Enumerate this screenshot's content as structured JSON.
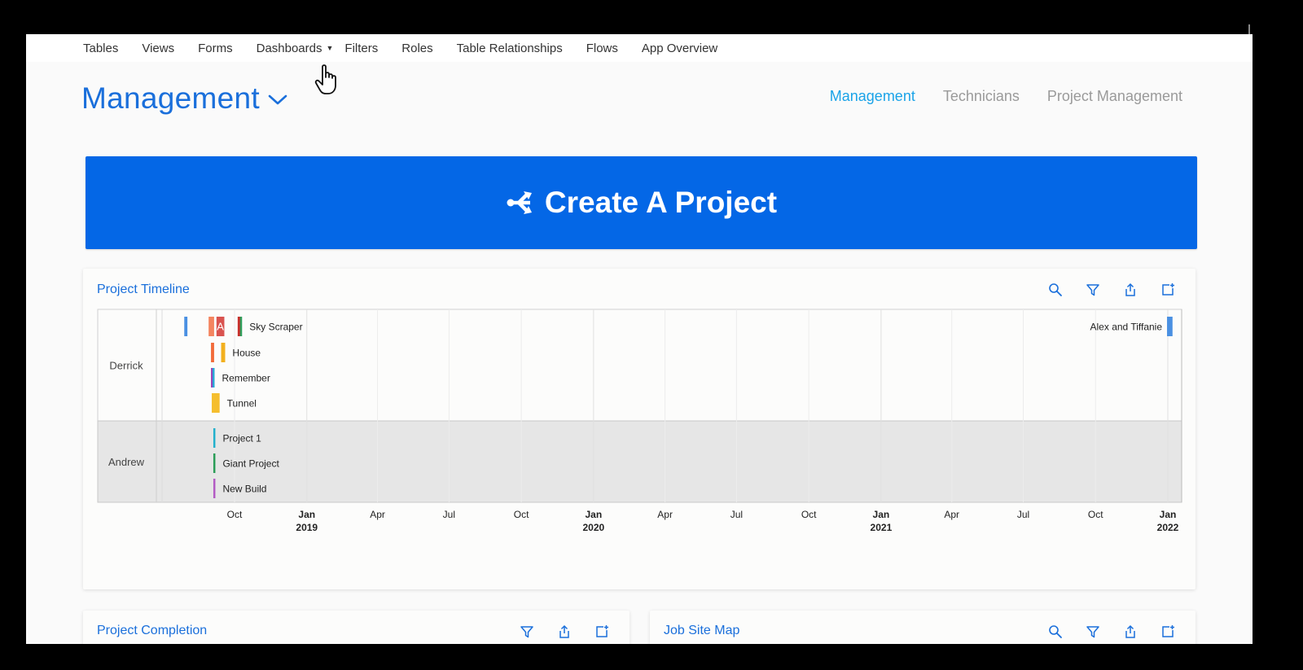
{
  "nav": {
    "items": [
      "Tables",
      "Views",
      "Forms",
      "Dashboards",
      "Filters",
      "Roles",
      "Table Relationships",
      "Flows",
      "App Overview"
    ],
    "dropdown_item": "Dashboards"
  },
  "page": {
    "title": "Management",
    "tabs": [
      {
        "label": "Management",
        "active": true
      },
      {
        "label": "Technicians",
        "active": false
      },
      {
        "label": "Project Management",
        "active": false
      }
    ]
  },
  "create_button": {
    "label": "Create A Project",
    "icon": "share-nodes-icon"
  },
  "timeline": {
    "title": "Project Timeline",
    "icons": [
      "search-icon",
      "filter-icon",
      "export-icon",
      "expand-icon"
    ]
  },
  "chart_data": {
    "type": "timeline",
    "rows": [
      "Derrick",
      "Andrew"
    ],
    "x_ticks": [
      {
        "month": "Oct",
        "year": ""
      },
      {
        "month": "Jan",
        "year": "2019"
      },
      {
        "month": "Apr",
        "year": ""
      },
      {
        "month": "Jul",
        "year": ""
      },
      {
        "month": "Oct",
        "year": ""
      },
      {
        "month": "Jan",
        "year": "2020"
      },
      {
        "month": "Apr",
        "year": ""
      },
      {
        "month": "Jul",
        "year": ""
      },
      {
        "month": "Oct",
        "year": ""
      },
      {
        "month": "Jan",
        "year": "2021"
      },
      {
        "month": "Apr",
        "year": ""
      },
      {
        "month": "Jul",
        "year": ""
      },
      {
        "month": "Oct",
        "year": ""
      },
      {
        "month": "Jan",
        "year": "2022"
      }
    ],
    "bars": [
      {
        "row": "Derrick",
        "lane": 0,
        "start": "2018-07-29",
        "end": "2018-08-02",
        "color": "#4a90e2",
        "label": ""
      },
      {
        "row": "Derrick",
        "lane": 0,
        "start": "2018-08-29",
        "end": "2018-09-05",
        "color": "#f4845f",
        "label": ""
      },
      {
        "row": "Derrick",
        "lane": 0,
        "start": "2018-09-08",
        "end": "2018-09-18",
        "color": "#d9534f",
        "label": "A"
      },
      {
        "row": "Derrick",
        "lane": 0,
        "start": "2018-10-05",
        "end": "2018-10-09",
        "color": "#c9302c",
        "label": ""
      },
      {
        "row": "Derrick",
        "lane": 0,
        "start": "2018-10-08",
        "end": "2018-10-10",
        "color": "#2e9e5b",
        "label": "Sky Scraper"
      },
      {
        "row": "Derrick",
        "lane": 0,
        "start": "2021-12-31",
        "end": "2022-01-07",
        "color": "#4a90e2",
        "label": "Alex and Tiffanie"
      },
      {
        "row": "Derrick",
        "lane": 1,
        "start": "2018-09-01",
        "end": "2018-09-05",
        "color": "#f26b3a",
        "label": ""
      },
      {
        "row": "Derrick",
        "lane": 1,
        "start": "2018-09-14",
        "end": "2018-09-19",
        "color": "#f2b01e",
        "label": "House"
      },
      {
        "row": "Derrick",
        "lane": 1,
        "start": "2018-09-14",
        "end": "2018-09-19",
        "color": "#f2b01e",
        "label": ""
      },
      {
        "row": "Derrick",
        "lane": 2,
        "start": "2018-09-01",
        "end": "2018-09-03",
        "color": "#9b3fb5",
        "label": ""
      },
      {
        "row": "Derrick",
        "lane": 2,
        "start": "2018-09-03",
        "end": "2018-09-04",
        "color": "#29a9d6",
        "label": "Remember"
      },
      {
        "row": "Derrick",
        "lane": 3,
        "start": "2018-09-02",
        "end": "2018-09-12",
        "color": "#f5be2e",
        "label": "Tunnel"
      },
      {
        "row": "Andrew",
        "lane": 0,
        "start": "2018-09-04",
        "end": "2018-09-06",
        "color": "#22b0cc",
        "label": "Project 1"
      },
      {
        "row": "Andrew",
        "lane": 1,
        "start": "2018-09-04",
        "end": "2018-09-05",
        "color": "#2a9d57",
        "label": "Giant Project"
      },
      {
        "row": "Andrew",
        "lane": 2,
        "start": "2018-09-04",
        "end": "2018-09-05",
        "color": "#b35bc4",
        "label": "New Build"
      }
    ]
  },
  "bottom_cards": [
    {
      "title": "Project Completion",
      "icons": [
        "filter-icon",
        "export-icon",
        "expand-icon"
      ]
    },
    {
      "title": "Job Site Map",
      "icons": [
        "search-icon",
        "filter-icon",
        "export-icon",
        "expand-icon"
      ]
    }
  ]
}
